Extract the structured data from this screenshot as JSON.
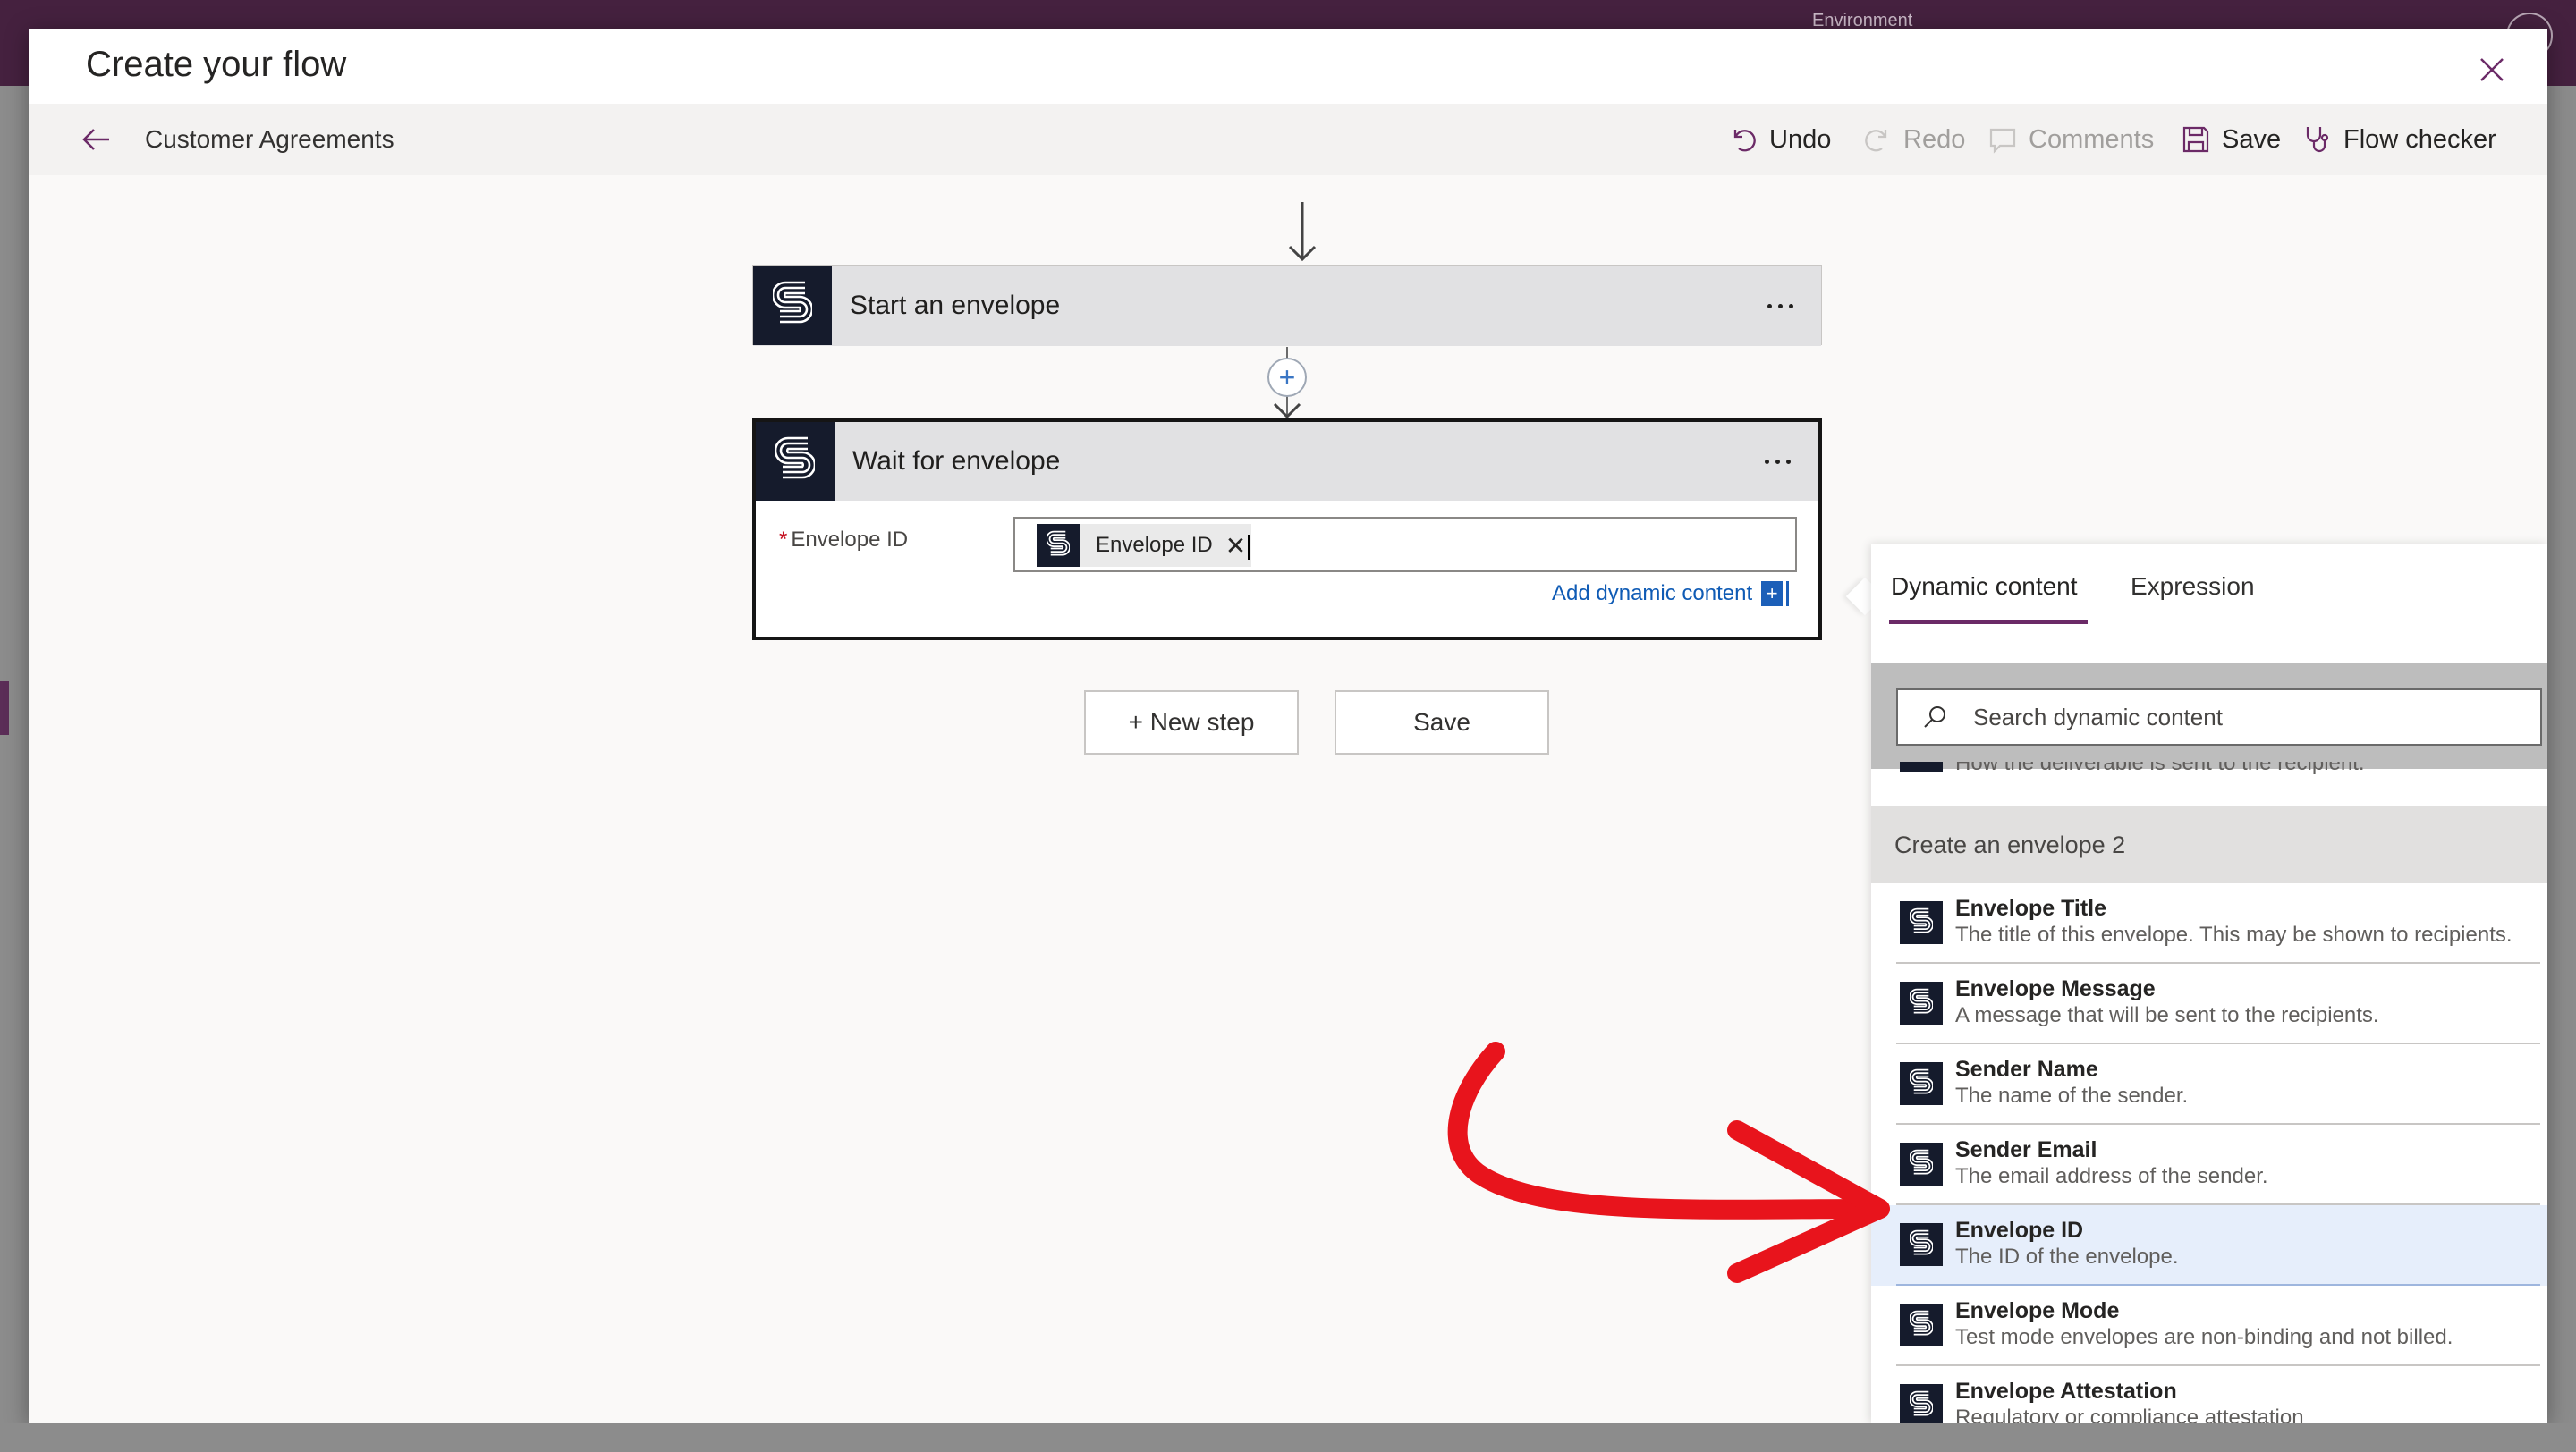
{
  "background": {
    "environment_label": "Environment"
  },
  "modal": {
    "title": "Create your flow",
    "flow_name": "Customer Agreements",
    "commands": {
      "undo": "Undo",
      "redo": "Redo",
      "comments": "Comments",
      "save": "Save",
      "flow_checker": "Flow checker"
    }
  },
  "flow": {
    "steps": [
      {
        "title": "Start an envelope"
      },
      {
        "title": "Wait for envelope",
        "field_label": "Envelope ID",
        "token_label": "Envelope ID",
        "add_dynamic_label": "Add dynamic content"
      }
    ],
    "new_step_label": "+ New step",
    "save_label": "Save"
  },
  "dynamic_panel": {
    "tabs": [
      "Dynamic content",
      "Expression"
    ],
    "active_tab": "Dynamic content",
    "search_placeholder": "Search dynamic content",
    "partial_item_text": "How the deliverable is sent to the recipient.",
    "group_title": "Create an envelope 2",
    "items": [
      {
        "title": "Envelope Title",
        "description": "The title of this envelope. This may be shown to recipients."
      },
      {
        "title": "Envelope Message",
        "description": "A message that will be sent to the recipients."
      },
      {
        "title": "Sender Name",
        "description": "The name of the sender."
      },
      {
        "title": "Sender Email",
        "description": "The email address of the sender."
      },
      {
        "title": "Envelope ID",
        "description": "The ID of the envelope.",
        "selected": true
      },
      {
        "title": "Envelope Mode",
        "description": "Test mode envelopes are non-binding and not billed."
      },
      {
        "title": "Envelope Attestation",
        "description": "Regulatory or compliance attestation"
      }
    ]
  },
  "colors": {
    "topbar": "#45213f",
    "accent": "#6b2a67",
    "link": "#0f5bb5",
    "connector_logo": "#151b2c",
    "annotation_arrow": "#e8141c"
  }
}
